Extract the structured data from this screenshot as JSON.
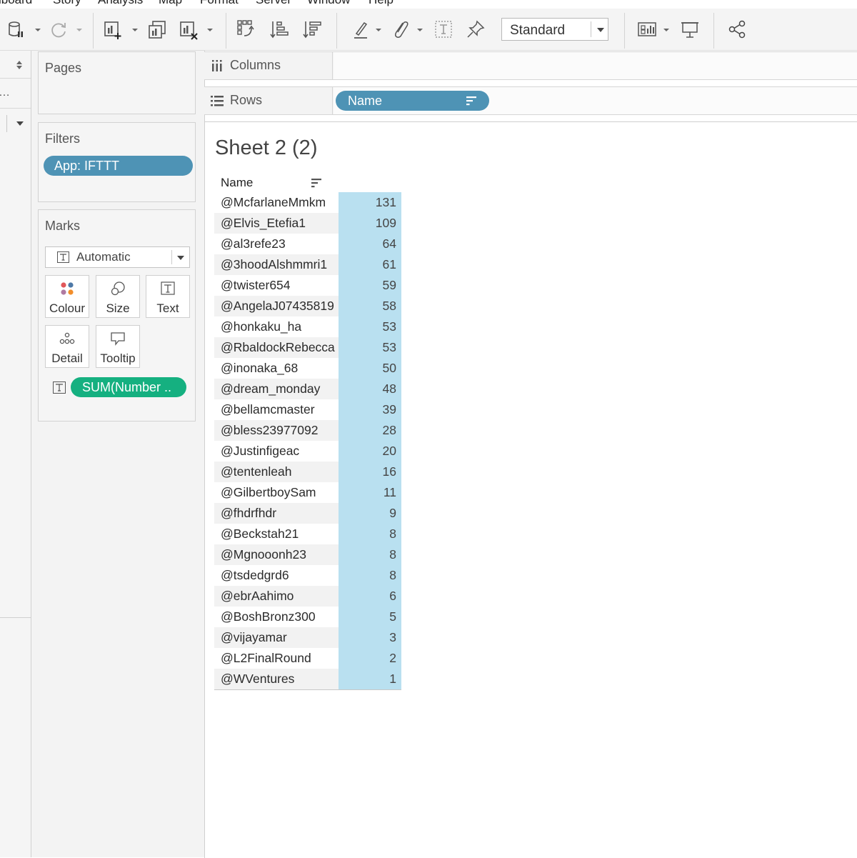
{
  "menubar": {
    "items": [
      "iboard",
      "Story",
      "Analysis",
      "Map",
      "Format",
      "Server",
      "Window",
      "Help"
    ]
  },
  "toolbar": {
    "fit_label": "Standard",
    "icons": [
      "pause-data-icon",
      "refresh-icon",
      "new-worksheet-icon",
      "duplicate-sheet-icon",
      "clear-sheet-icon",
      "swap-axes-icon",
      "sort-ascending-icon",
      "sort-descending-icon",
      "highlight-icon",
      "group-icon",
      "show-mark-labels-icon",
      "pin-icon",
      "show-me-icon",
      "presentation-icon",
      "share-icon"
    ]
  },
  "pages_card": {
    "title": "Pages"
  },
  "filters_card": {
    "title": "Filters",
    "filter_pill": "App: IFTTT"
  },
  "marks_card": {
    "title": "Marks",
    "mark_type": "Automatic",
    "buttons": {
      "colour": "Colour",
      "size": "Size",
      "text": "Text",
      "detail": "Detail",
      "tooltip": "Tooltip"
    },
    "field_pill": "SUM(Number .."
  },
  "shelves": {
    "columns_label": "Columns",
    "rows_label": "Rows",
    "rows_pill": "Name"
  },
  "view": {
    "sheet_title": "Sheet 2 (2)",
    "column_header": "Name",
    "rows": [
      {
        "name": "@McfarlaneMmkm",
        "value": "131"
      },
      {
        "name": "@Elvis_Etefia1",
        "value": "109"
      },
      {
        "name": "@al3refe23",
        "value": "64"
      },
      {
        "name": "@3hoodAlshmmri1",
        "value": "61"
      },
      {
        "name": "@twister654",
        "value": "59"
      },
      {
        "name": "@AngelaJ07435819",
        "value": "58"
      },
      {
        "name": "@honkaku_ha",
        "value": "53"
      },
      {
        "name": "@RbaldockRebecca",
        "value": "53"
      },
      {
        "name": "@inonaka_68",
        "value": "50"
      },
      {
        "name": "@dream_monday",
        "value": "48"
      },
      {
        "name": "@bellamcmaster",
        "value": "39"
      },
      {
        "name": "@bless23977092",
        "value": "28"
      },
      {
        "name": "@Justinfigeac",
        "value": "20"
      },
      {
        "name": "@tentenleah",
        "value": "16"
      },
      {
        "name": "@GilbertboySam",
        "value": "11"
      },
      {
        "name": "@fhdrfhdr",
        "value": "9"
      },
      {
        "name": "@Beckstah21",
        "value": "8"
      },
      {
        "name": "@Mgnooonh23",
        "value": "8"
      },
      {
        "name": "@tsdedgrd6",
        "value": "8"
      },
      {
        "name": "@ebrAahimo",
        "value": "6"
      },
      {
        "name": "@BoshBronz300",
        "value": "5"
      },
      {
        "name": "@vijayamar",
        "value": "3"
      },
      {
        "name": "@L2FinalRound",
        "value": "2"
      },
      {
        "name": "@WVentures",
        "value": "1"
      }
    ]
  },
  "colors": {
    "pill_blue": "#4e93b5",
    "pill_green": "#15b080",
    "value_cell": "#b9e0f0",
    "row_stripe": "#f2f2f2"
  }
}
